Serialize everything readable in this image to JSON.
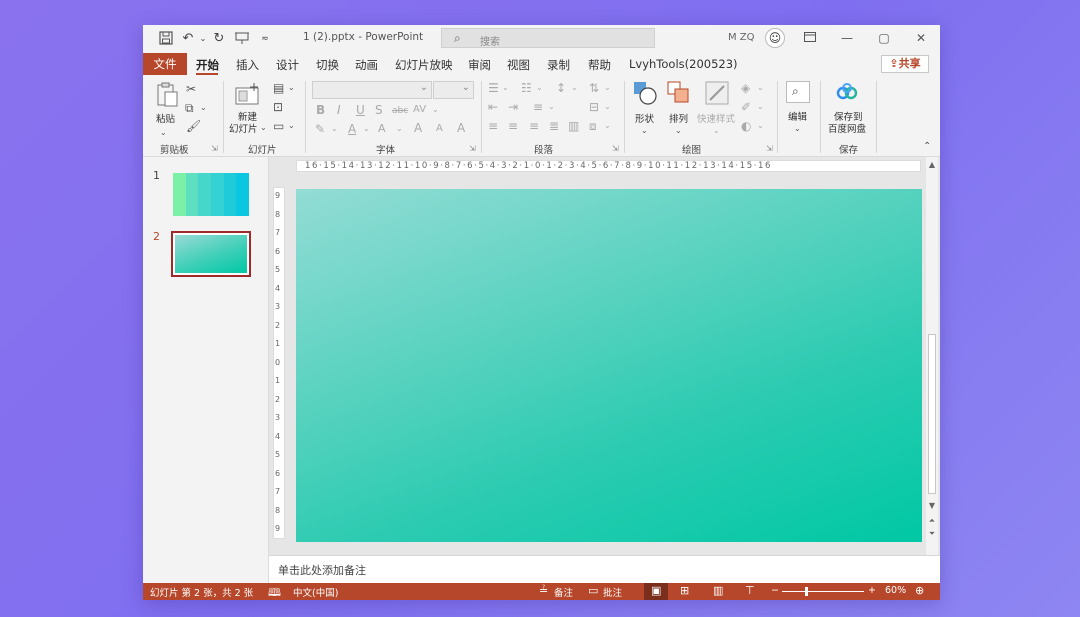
{
  "window": {
    "title": "1 (2).pptx  -  PowerPoint",
    "search_placeholder": "搜索",
    "user": "M ZQ"
  },
  "quick_access": [
    "save-icon",
    "undo-icon",
    "redo-icon",
    "present-icon"
  ],
  "tabs": {
    "file": "文件",
    "items": [
      "开始",
      "插入",
      "设计",
      "切换",
      "动画",
      "幻灯片放映",
      "审阅",
      "视图",
      "录制",
      "帮助",
      "LvyhTools(200523)"
    ],
    "active": "开始",
    "share": "共享"
  },
  "ribbon": {
    "clipboard": {
      "paste": "粘贴",
      "group": "剪贴板"
    },
    "slides": {
      "new_slide": "新建\n幻灯片",
      "new_slide_a": "新建",
      "new_slide_b": "幻灯片",
      "group": "幻灯片"
    },
    "font": {
      "bold": "B",
      "italic": "I",
      "underline": "U",
      "shadow": "S",
      "strike": "abc",
      "spacing": "AV",
      "grow": "A",
      "shrink": "A",
      "clear": "A",
      "group": "字体"
    },
    "paragraph": {
      "group": "段落"
    },
    "drawing": {
      "shapes": "形状",
      "arrange": "排列",
      "quick_styles": "快速样式",
      "group": "绘图"
    },
    "editing": {
      "label": "编辑"
    },
    "save": {
      "label_a": "保存到",
      "label_b": "百度网盘",
      "group": "保存"
    }
  },
  "ruler": {
    "horizontal": "16·15·14·13·12·11·10·9·8·7·6·5·4·3·2·1·0·1·2·3·4·5·6·7·8·9·10·11·12·13·14·15·16",
    "vertical": [
      "9",
      "8",
      "7",
      "6",
      "5",
      "4",
      "3",
      "2",
      "1",
      "0",
      "1",
      "2",
      "3",
      "4",
      "5",
      "6",
      "7",
      "8",
      "9"
    ]
  },
  "slides_pane": {
    "slides": [
      {
        "number": "1",
        "colors": [
          "#7cf0a6",
          "#5ee0c0",
          "#45d7c9",
          "#34d2d2",
          "#1fcad9",
          "#0bc6e0"
        ]
      },
      {
        "number": "2",
        "selected": true
      }
    ]
  },
  "slide": {
    "gradient_start": "#93dcd5",
    "gradient_end": "#00c8a4"
  },
  "notes": {
    "placeholder": "单击此处添加备注"
  },
  "status": {
    "slide_info": "幻灯片 第 2 张，共 2 张",
    "language": "中文(中国)",
    "notes": "备注",
    "comments": "批注",
    "zoom": "60%"
  },
  "colors": {
    "accent": "#b7472a",
    "background": "#8a72ee"
  }
}
